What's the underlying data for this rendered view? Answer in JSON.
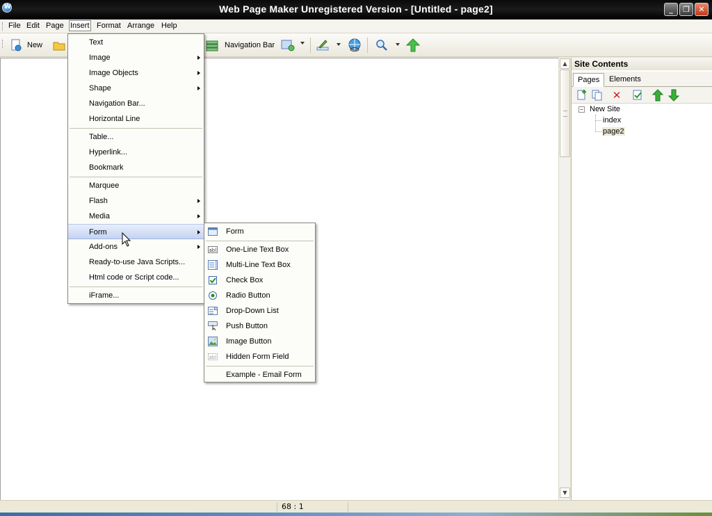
{
  "window": {
    "title": "Web Page Maker Unregistered Version - [Untitled - page2]"
  },
  "menubar": {
    "file": "File",
    "edit": "Edit",
    "page": "Page",
    "insert": "Insert",
    "format": "Format",
    "arrange": "Arrange",
    "help": "Help"
  },
  "toolbar": {
    "new_label": "New",
    "navbar_label": "Navigation Bar"
  },
  "insert_menu": {
    "text": "Text",
    "image": "Image",
    "image_objects": "Image Objects",
    "shape": "Shape",
    "navigation_bar": "Navigation Bar...",
    "horizontal_line": "Horizontal Line",
    "table": "Table...",
    "hyperlink": "Hyperlink...",
    "bookmark": "Bookmark",
    "marquee": "Marquee",
    "flash": "Flash",
    "media": "Media",
    "form": "Form",
    "add_ons": "Add-ons",
    "java_scripts": "Ready-to-use Java Scripts...",
    "html_code": "Html code or Script code...",
    "iframe": "iFrame..."
  },
  "form_submenu": {
    "form": "Form",
    "one_line": "One-Line Text Box",
    "multi_line": "Multi-Line Text Box",
    "check_box": "Check Box",
    "radio": "Radio Button",
    "dropdown": "Drop-Down List",
    "push_button": "Push Button",
    "image_button": "Image Button",
    "hidden_field": "Hidden Form Field",
    "example_email": "Example - Email Form"
  },
  "site_panel": {
    "title": "Site Contents",
    "tabs": {
      "pages": "Pages",
      "elements": "Elements"
    },
    "tree": {
      "root": "New Site",
      "page1": "index",
      "page2": "page2"
    }
  },
  "statusbar": {
    "position": "68 : 1"
  },
  "colors": {
    "titlebar": "#0a0a0a",
    "menu_highlight": "#c4d3f2",
    "panel_bg": "#ffffff"
  }
}
